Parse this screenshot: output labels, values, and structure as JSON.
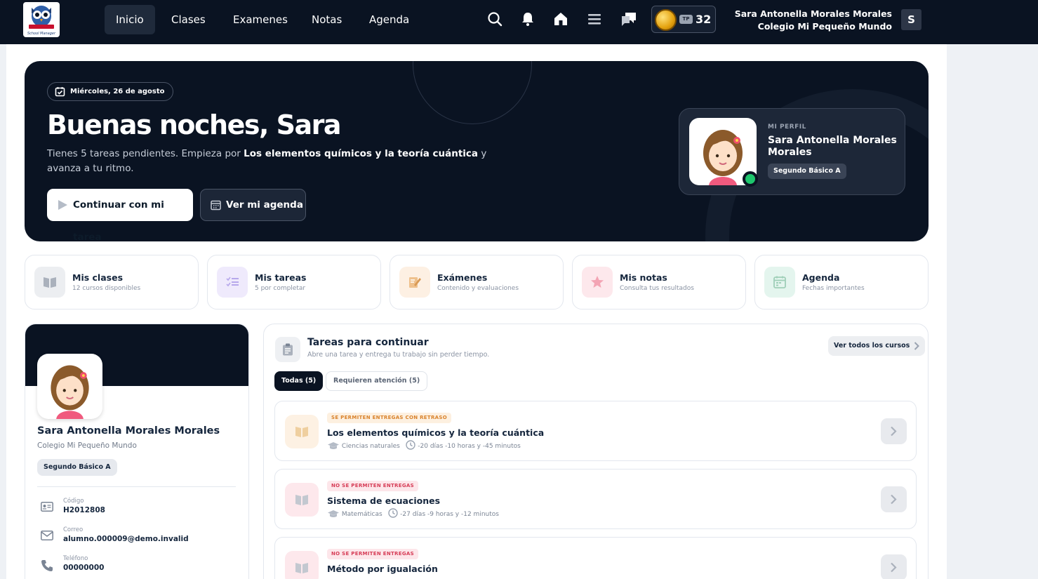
{
  "nav": {
    "items": [
      "Inicio",
      "Clases",
      "Examenes",
      "Notas",
      "Agenda"
    ],
    "active": "Inicio"
  },
  "topbar": {
    "tp_badge": "TP",
    "points": "32",
    "user_name": "Sara Antonella Morales Morales",
    "school": "Colegio Mi Pequeño Mundo",
    "initial": "S"
  },
  "hero": {
    "date": "Miércoles, 26 de agosto",
    "greeting": "Buenas noches, Sara",
    "subtitle_pre": "Tienes 5 tareas pendientes. Empieza por ",
    "subtitle_task": "Los elementos químicos y la teoría cuántica",
    "subtitle_post": " y avanza a tu ritmo.",
    "btn_continue": "Continuar con mi tarea",
    "btn_agenda": "Ver mi agenda",
    "profile_kicker": "MI PERFIL",
    "profile_name": "Sara Antonella Morales Morales",
    "profile_grade": "Segundo Básico A"
  },
  "quick": [
    {
      "title": "Mis clases",
      "sub": "12 cursos disponibles",
      "color": "#eceef1",
      "icon": "book-icon"
    },
    {
      "title": "Mis tareas",
      "sub": "5 por completar",
      "color": "#efeafc",
      "icon": "checklist-icon"
    },
    {
      "title": "Exámenes",
      "sub": "Contenido y evaluaciones",
      "color": "#fdf0e3",
      "icon": "exam-icon"
    },
    {
      "title": "Mis notas",
      "sub": "Consulta tus resultados",
      "color": "#fde8ec",
      "icon": "star-icon"
    },
    {
      "title": "Agenda",
      "sub": "Fechas importantes",
      "color": "#e4f5ee",
      "icon": "calendar-icon"
    }
  ],
  "student": {
    "name": "Sara Antonella Morales Morales",
    "school": "Colegio Mi Pequeño Mundo",
    "grade": "Segundo Básico A",
    "code_label": "Código",
    "code": "H2012808",
    "email_label": "Correo",
    "email": "alumno.000009@demo.invalid",
    "phone_label": "Teléfono",
    "phone": "00000000"
  },
  "tasks": {
    "title": "Tareas para continuar",
    "subtitle": "Abre una tarea y entrega tu trabajo sin perder tiempo.",
    "see_all": "Ver todos los cursos",
    "tab_all": "Todas (5)",
    "tab_attention": "Requieren atención (5)",
    "items": [
      {
        "badge": "SE PERMITEN ENTREGAS CON RETRASO",
        "badge_bg": "#fdf0e0",
        "badge_fg": "#d9822b",
        "icon_bg": "#fdf1e3",
        "name": "Los elementos químicos y la teoría cuántica",
        "subject": "Ciencias naturales",
        "time": "-20 días -10 horas y -45 minutos"
      },
      {
        "badge": "NO SE PERMITEN ENTREGAS",
        "badge_bg": "#fde6ea",
        "badge_fg": "#d63b55",
        "icon_bg": "#fde8ec",
        "name": "Sistema de ecuaciones",
        "subject": "Matemáticas",
        "time": "-27 días -9 horas y -12 minutos"
      },
      {
        "badge": "NO SE PERMITEN ENTREGAS",
        "badge_bg": "#fde6ea",
        "badge_fg": "#d63b55",
        "icon_bg": "#fde8ec",
        "name": "Método por igualación",
        "subject": "",
        "time": ""
      }
    ]
  }
}
